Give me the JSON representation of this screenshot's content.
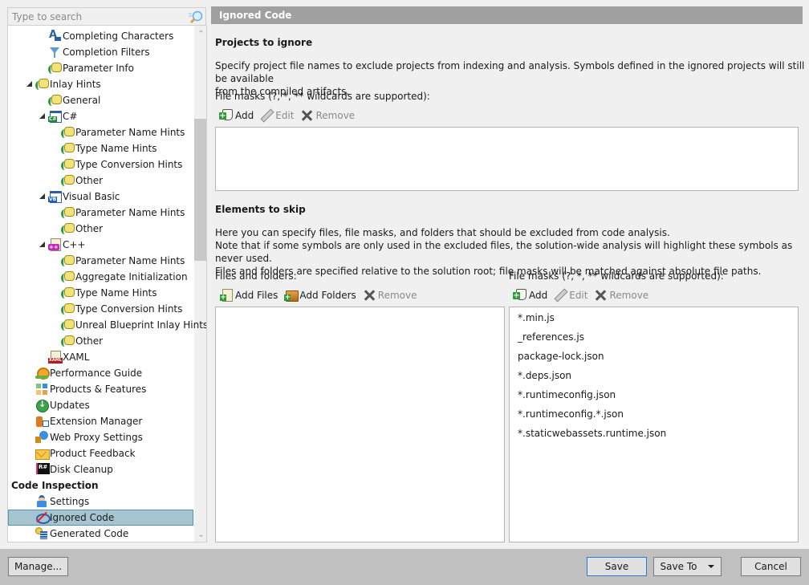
{
  "search": {
    "placeholder": "Type to search",
    "value": ""
  },
  "tree": {
    "items": [
      {
        "label": "Completing Characters",
        "icon": "font-icon",
        "indent": 3,
        "expandable": false
      },
      {
        "label": "Completion Filters",
        "icon": "filter-icon",
        "indent": 3,
        "expandable": false
      },
      {
        "label": "Parameter Info",
        "icon": "bubble-icon",
        "indent": 3,
        "expandable": false
      },
      {
        "label": "Inlay Hints",
        "icon": "bubble-icon",
        "indent": 2,
        "expandable": true
      },
      {
        "label": "General",
        "icon": "bubble-icon",
        "indent": 3,
        "expandable": false
      },
      {
        "label": "C#",
        "icon": "csharp-icon",
        "indent": 3,
        "expandable": true
      },
      {
        "label": "Parameter Name Hints",
        "icon": "bubble-icon",
        "indent": 4,
        "expandable": false
      },
      {
        "label": "Type Name Hints",
        "icon": "bubble-icon",
        "indent": 4,
        "expandable": false
      },
      {
        "label": "Type Conversion Hints",
        "icon": "bubble-icon",
        "indent": 4,
        "expandable": false
      },
      {
        "label": "Other",
        "icon": "bubble-icon",
        "indent": 4,
        "expandable": false
      },
      {
        "label": "Visual Basic",
        "icon": "vb-icon",
        "indent": 3,
        "expandable": true
      },
      {
        "label": "Parameter Name Hints",
        "icon": "bubble-icon",
        "indent": 4,
        "expandable": false
      },
      {
        "label": "Other",
        "icon": "bubble-icon",
        "indent": 4,
        "expandable": false
      },
      {
        "label": "C++",
        "icon": "cpp-icon",
        "indent": 3,
        "expandable": true
      },
      {
        "label": "Parameter Name Hints",
        "icon": "bubble-icon",
        "indent": 4,
        "expandable": false
      },
      {
        "label": "Aggregate Initialization",
        "icon": "bubble-icon",
        "indent": 4,
        "expandable": false
      },
      {
        "label": "Type Name Hints",
        "icon": "bubble-icon",
        "indent": 4,
        "expandable": false
      },
      {
        "label": "Type Conversion Hints",
        "icon": "bubble-icon",
        "indent": 4,
        "expandable": false
      },
      {
        "label": "Unreal Blueprint Inlay Hints",
        "icon": "bubble-icon",
        "indent": 4,
        "expandable": false
      },
      {
        "label": "Other",
        "icon": "bubble-icon",
        "indent": 4,
        "expandable": false
      },
      {
        "label": "XAML",
        "icon": "xaml-icon",
        "indent": 3,
        "expandable": false
      },
      {
        "label": "Performance Guide",
        "icon": "snail-icon",
        "indent": 2,
        "expandable": false
      },
      {
        "label": "Products & Features",
        "icon": "products-icon",
        "indent": 2,
        "expandable": false
      },
      {
        "label": "Updates",
        "icon": "update-icon",
        "indent": 2,
        "expandable": false
      },
      {
        "label": "Extension Manager",
        "icon": "extension-icon",
        "indent": 2,
        "expandable": false
      },
      {
        "label": "Web Proxy Settings",
        "icon": "proxy-icon",
        "indent": 2,
        "expandable": false
      },
      {
        "label": "Product Feedback",
        "icon": "mail-icon",
        "indent": 2,
        "expandable": false
      },
      {
        "label": "Disk Cleanup",
        "icon": "resharper-icon",
        "indent": 2,
        "expandable": false
      },
      {
        "label": "Code Inspection",
        "icon": "",
        "indent": 0,
        "expandable": true,
        "bold": true
      },
      {
        "label": "Settings",
        "icon": "settings-person-icon",
        "indent": 2,
        "expandable": false
      },
      {
        "label": "Ignored Code",
        "icon": "ignored-eye-icon",
        "indent": 2,
        "expandable": false,
        "selected": true
      },
      {
        "label": "Generated Code",
        "icon": "generated-code-icon",
        "indent": 2,
        "expandable": false
      }
    ],
    "scroll_position_fraction": 0.18
  },
  "page": {
    "header": "Ignored Code",
    "projects": {
      "title": "Projects to ignore",
      "description_line1": "Specify project file names to exclude projects from indexing and analysis. Symbols defined in the ignored projects will still be available",
      "description_line2": "from the compiled artifacts.",
      "masks_label": "File masks (?, *, ** wildcards are supported):",
      "toolbar": {
        "add": "Add",
        "edit": "Edit",
        "remove": "Remove"
      },
      "items": []
    },
    "elements": {
      "title": "Elements to skip",
      "description_line1": "Here you can specify files, file masks, and folders that should be excluded from code analysis.",
      "description_line2": "Note that if some symbols are only used in the excluded files, the solution-wide analysis will highlight these symbols as never used.",
      "description_line3": "Files and folders are specified relative to the solution root; file masks will be matched against absolute file paths.",
      "files_label": "Files and folders:",
      "files_toolbar": {
        "add_files": "Add Files",
        "add_folders": "Add Folders",
        "remove": "Remove"
      },
      "files_items": [],
      "masks_label": "File masks (?, *, ** wildcards are supported):",
      "masks_toolbar": {
        "add": "Add",
        "edit": "Edit",
        "remove": "Remove"
      },
      "masks_items": [
        "*.min.js",
        "_references.js",
        "package-lock.json",
        "*.deps.json",
        "*.runtimeconfig.json",
        "*.runtimeconfig.*.json",
        "*.staticwebassets.runtime.json"
      ]
    }
  },
  "footer": {
    "manage": "Manage...",
    "save": "Save",
    "save_to": "Save To",
    "cancel": "Cancel"
  }
}
